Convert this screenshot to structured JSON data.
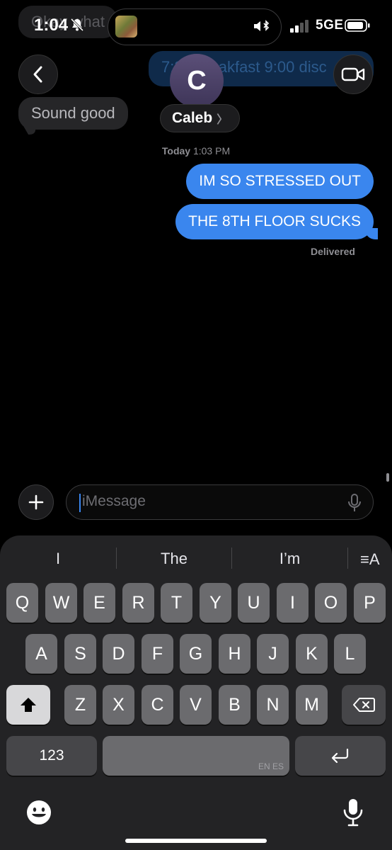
{
  "status_bar": {
    "time": "1:04",
    "network": "5GE"
  },
  "background_messages": {
    "faded_left": "Okay what",
    "faded_right": "7:30 breakfast 9:00 disc",
    "received": "Sound good"
  },
  "header": {
    "avatar_initial": "C",
    "contact_name": "Caleb",
    "chevron": "〉"
  },
  "conversation": {
    "timestamp_day": "Today",
    "timestamp_time": "1:03 PM",
    "messages": [
      {
        "text": "IM SO STRESSED OUT"
      },
      {
        "text": "THE 8TH FLOOR SUCKS"
      }
    ],
    "status": "Delivered"
  },
  "compose": {
    "placeholder": "iMessage"
  },
  "keyboard": {
    "suggestions": [
      "I",
      "The",
      "I’m"
    ],
    "format_label": "≡A",
    "row1": [
      "Q",
      "W",
      "E",
      "R",
      "T",
      "Y",
      "U",
      "I",
      "O",
      "P"
    ],
    "row2": [
      "A",
      "S",
      "D",
      "F",
      "G",
      "H",
      "J",
      "K",
      "L"
    ],
    "row3": [
      "Z",
      "X",
      "C",
      "V",
      "B",
      "N",
      "M"
    ],
    "numbers_label": "123",
    "space_lang": "EN ES"
  },
  "colors": {
    "bubble_blue": "#3a86ee",
    "background": "#000000",
    "keyboard": "#232325"
  },
  "icons": [
    "bell-slash-icon",
    "bluetooth-icon",
    "signal-icon",
    "battery-icon",
    "back-chevron-icon",
    "video-camera-icon",
    "plus-icon",
    "microphone-icon",
    "shift-icon",
    "delete-icon",
    "return-icon",
    "emoji-icon"
  ]
}
